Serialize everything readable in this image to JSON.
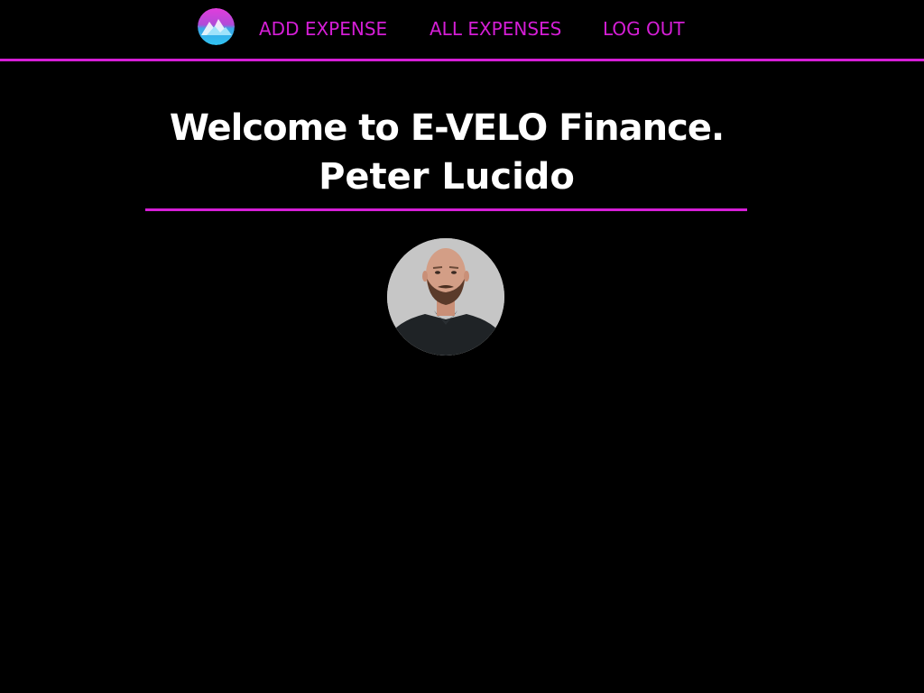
{
  "nav": {
    "logo_icon": "mountain-logo-icon",
    "links": [
      {
        "label": "ADD EXPENSE"
      },
      {
        "label": "ALL EXPENSES"
      },
      {
        "label": "LOG OUT"
      }
    ]
  },
  "hero": {
    "title": "Welcome to E-VELO Finance.",
    "user_name": "Peter Lucido"
  },
  "profile": {
    "avatar_icon": "user-photo-avatar"
  },
  "colors": {
    "accent": "#d51ed6",
    "background": "#000000",
    "text": "#ffffff"
  }
}
